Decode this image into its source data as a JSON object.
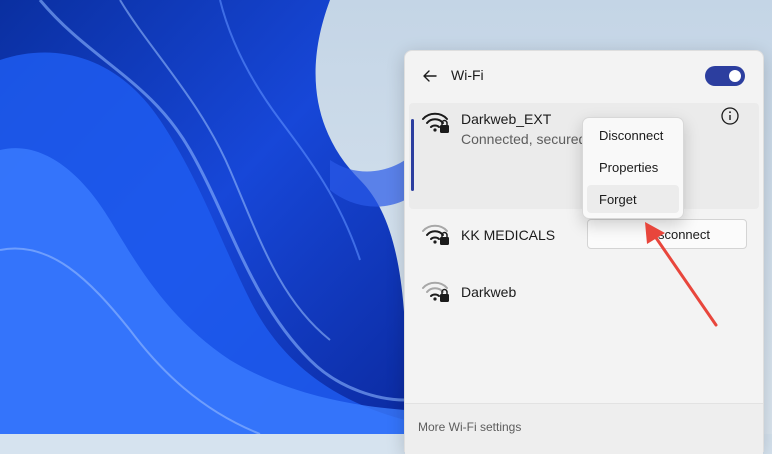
{
  "panel": {
    "title": "Wi-Fi",
    "wifi_enabled": true
  },
  "networks": [
    {
      "name": "Darkweb_EXT",
      "status": "Connected, secured",
      "action_label": "Disconnect",
      "icon": "wifi-lock-icon"
    },
    {
      "name": "KK MEDICALS",
      "icon": "wifi-lock-icon"
    },
    {
      "name": "Darkweb",
      "icon": "wifi-lock-icon"
    }
  ],
  "context_menu": {
    "items": [
      "Disconnect",
      "Properties",
      "Forget"
    ],
    "highlighted": "Forget"
  },
  "footer": {
    "link": "More Wi-Fi settings"
  },
  "colors": {
    "accent": "#2c3e9f",
    "annotation_arrow": "#e8463c"
  }
}
